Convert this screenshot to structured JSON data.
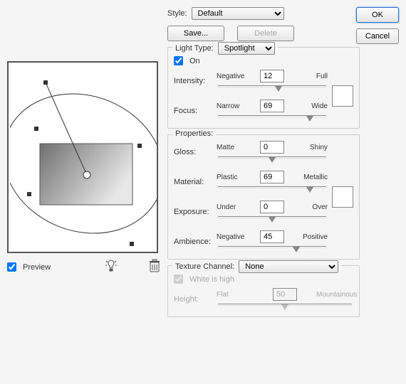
{
  "style": {
    "label": "Style:",
    "value": "Default"
  },
  "buttons": {
    "ok": "OK",
    "cancel": "Cancel",
    "save": "Save...",
    "delete": "Delete"
  },
  "preview": {
    "label": "Preview",
    "checked": true
  },
  "lightType": {
    "label": "Light Type:",
    "value": "Spotlight"
  },
  "on": {
    "label": "On",
    "checked": true
  },
  "intensity": {
    "label": "Intensity:",
    "min": "Negative",
    "max": "Full",
    "value": "12",
    "pct": 56
  },
  "focus": {
    "label": "Focus:",
    "min": "Narrow",
    "max": "Wide",
    "value": "69",
    "pct": 84
  },
  "properties": {
    "label": "Properties:"
  },
  "gloss": {
    "label": "Gloss:",
    "min": "Matte",
    "max": "Shiny",
    "value": "0",
    "pct": 50
  },
  "material": {
    "label": "Material:",
    "min": "Plastic",
    "max": "Metallic",
    "value": "69",
    "pct": 84
  },
  "exposure": {
    "label": "Exposure:",
    "min": "Under",
    "max": "Over",
    "value": "0",
    "pct": 50
  },
  "ambience": {
    "label": "Ambience:",
    "min": "Negative",
    "max": "Positive",
    "value": "45",
    "pct": 72
  },
  "texture": {
    "label": "Texture Channel:",
    "value": "None"
  },
  "whiteHigh": {
    "label": "White is high",
    "checked": true,
    "disabled": true
  },
  "height": {
    "label": "Height:",
    "min": "Flat",
    "max": "Mountainous",
    "value": "50",
    "pct": 50,
    "disabled": true
  },
  "swatch1": "#ffffff",
  "swatch2": "#ffffff"
}
